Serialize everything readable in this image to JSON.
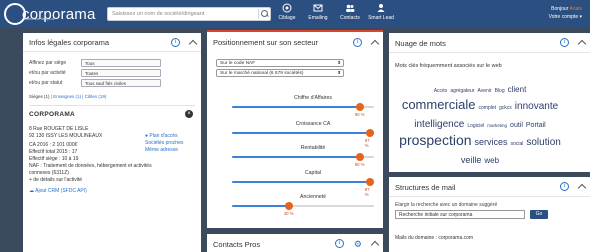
{
  "app": {
    "logo_text": "corporama",
    "logo_tagline": "Data base des pros",
    "search_placeholder": "Saisissez un nom de société/dirigeant"
  },
  "nav": [
    {
      "label": "Ciblage",
      "icon": "target-icon"
    },
    {
      "label": "Emailing",
      "icon": "envelope-icon"
    },
    {
      "label": "Contacts",
      "icon": "contacts-icon"
    },
    {
      "label": "Smart Lead",
      "icon": "smartlead-icon"
    }
  ],
  "user": {
    "greeting": "Bonjour",
    "name": "Anais",
    "account": "Votre compte ▾"
  },
  "legal": {
    "title": "Infos légales corporama",
    "filters": [
      {
        "label": "Affinez par siège",
        "value": "Tous"
      },
      {
        "label": "et/ou par activité",
        "value": "Toutes"
      },
      {
        "label": "et/ou par statut",
        "value": "Tous sauf fiés civiles"
      }
    ],
    "tabs": {
      "active": "Sièges (1)",
      "t2": "Enseignes (1)",
      "t3": "Cibles (19)"
    },
    "company": {
      "name": "CORPORAMA",
      "addr1": "8 Rue ROUGET DE LISLE",
      "addr2": "92 130 ISSY LES MOULINEAUX",
      "map": "Plan d'accès",
      "prox": "Sociétés proches",
      "same": "Même adresse",
      "ca": "CA 2016 : 2 101 000€",
      "effectif": "Effectif total 2015 : 17",
      "etab": "Effectif siège : 10 à 19",
      "naf1": "NAF : Traitement de données, hébergement et activités",
      "naf2": "connexes (6311Z)",
      "more": "+ de détails sur l'activité",
      "crm": "Ajout CRM (SFDC API)"
    }
  },
  "position": {
    "title": "Positionnement sur son secteur",
    "select1": "Sur le code NAF",
    "select2": "Sur le marché national (6 579 sociétés)",
    "metrics": [
      {
        "label": "Chiffre d'Affaires",
        "value": 90,
        "text": "90 %"
      },
      {
        "label": "Croissance CA",
        "value": 97,
        "text": "97 %"
      },
      {
        "label": "Rentabilité",
        "value": 90,
        "text": "90 %"
      },
      {
        "label": "Capital",
        "value": 97,
        "text": "97 %"
      },
      {
        "label": "Ancienneté",
        "value": 40,
        "text": "40 %"
      }
    ]
  },
  "contacts": {
    "title": "Contacts Pros"
  },
  "cloud": {
    "title": "Nuage de mots",
    "subtitle": "Mots clés fréquemment associés sur le web",
    "words": [
      {
        "w": "Accès",
        "s": 5
      },
      {
        "w": "agrégateur",
        "s": 5
      },
      {
        "w": "Avenir",
        "s": 5
      },
      {
        "w": "Blog",
        "s": 5
      },
      {
        "w": "client",
        "s": 8
      },
      {
        "w": "commerciale",
        "s": 13
      },
      {
        "w": "complet",
        "s": 5
      },
      {
        "w": "gckcs",
        "s": 5
      },
      {
        "w": "innovante",
        "s": 10
      },
      {
        "w": "intelligence",
        "s": 10
      },
      {
        "w": "Logiciel",
        "s": 5
      },
      {
        "w": "marketing",
        "s": 4.5
      },
      {
        "w": "outil",
        "s": 7
      },
      {
        "w": "Portail",
        "s": 7
      },
      {
        "w": "prospection",
        "s": 14
      },
      {
        "w": "services",
        "s": 9
      },
      {
        "w": "social",
        "s": 5
      },
      {
        "w": "solution",
        "s": 10
      },
      {
        "w": "veille",
        "s": 9
      },
      {
        "w": "web",
        "s": 8
      }
    ]
  },
  "mail": {
    "title": "Structures de mail",
    "hint": "Elargir la recherche avec un domaine suggéré",
    "value": "Recherche initiale sur corporama",
    "go": "Go",
    "domain": "Mails du domaine : corporama.com"
  },
  "colors": {
    "header": "#2a4f80",
    "accent": "#d9442f",
    "bar": "#3d82d6",
    "dot": "#e8621a"
  }
}
